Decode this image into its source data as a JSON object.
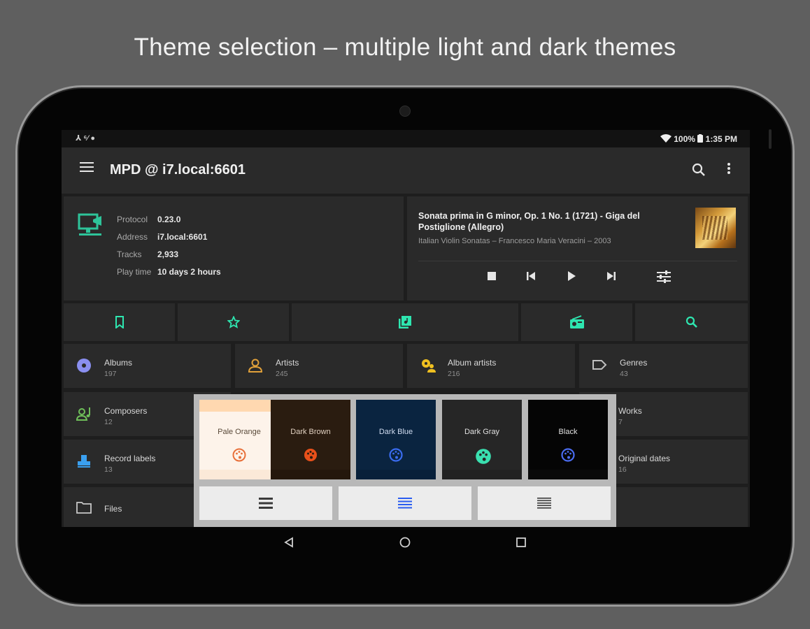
{
  "headline": "Theme selection – multiple light and dark themes",
  "status": {
    "battery": "100%",
    "time": "1:35 PM",
    "left_icons": "⅄  ⁶⁄  ●"
  },
  "toolbar": {
    "title": "MPD @ i7.local:6601",
    "search_icon": "search-icon",
    "more_icon": "more-vert-icon",
    "menu_icon": "menu-icon"
  },
  "server": {
    "rows": [
      {
        "key": "Protocol",
        "value": "0.23.0"
      },
      {
        "key": "Address",
        "value": "i7.local:6601"
      },
      {
        "key": "Tracks",
        "value": "2,933"
      },
      {
        "key": "Play time",
        "value": "10 days 2 hours"
      }
    ]
  },
  "player": {
    "track": "Sonata prima in G minor, Op. 1 No. 1 (1721) - Giga del Postiglione (Allegro)",
    "subtitle": "Italian Violin Sonatas – Francesco Maria Veracini – 2003"
  },
  "quick_actions": [
    "bookmark-icon",
    "star-icon",
    "library-icon",
    "radio-icon",
    "search-icon"
  ],
  "library": [
    {
      "name": "Albums",
      "count": "197",
      "icon": "album-icon",
      "color": "#8a8ff0"
    },
    {
      "name": "Artists",
      "count": "245",
      "icon": "person-icon",
      "color": "#e0a03a"
    },
    {
      "name": "Album artists",
      "count": "216",
      "icon": "group-icon",
      "color": "#f0c020"
    },
    {
      "name": "Genres",
      "count": "43",
      "icon": "label-icon",
      "color": "#bfbfbf"
    },
    {
      "name": "Composers",
      "count": "12",
      "icon": "composer-icon",
      "color": "#6fbf5a"
    },
    {
      "name": "Works",
      "count": "7",
      "icon": "works-icon",
      "color": "#bfbfbf"
    },
    {
      "name": "Record labels",
      "count": "13",
      "icon": "record-label-icon",
      "color": "#3aa0f0"
    },
    {
      "name": "Original dates",
      "count": "16",
      "icon": "calendar-icon",
      "color": "#bfbfbf"
    },
    {
      "name": "Files",
      "count": "",
      "icon": "folder-icon",
      "color": "#c8c8c8"
    }
  ],
  "themes": [
    {
      "name": "Pale Orange",
      "bg": "#fdf3ea",
      "top": "#ffd8b0",
      "fg": "#5a4a3a",
      "icon": "#e8703a",
      "selected": false
    },
    {
      "name": "Dark Brown",
      "bg": "#2a1c10",
      "top": "#2a1c10",
      "fg": "#e0d0c0",
      "icon": "#e8501a",
      "selected": false
    },
    {
      "name": "Dark Blue",
      "bg": "#0a2440",
      "top": "#0a2440",
      "fg": "#d0dcf0",
      "icon": "#3a6cf0",
      "selected": false
    },
    {
      "name": "Dark Gray",
      "bg": "#262626",
      "top": "#262626",
      "fg": "#e0e0e0",
      "icon": "#3ae0b0",
      "selected": false
    },
    {
      "name": "Black",
      "bg": "#050505",
      "top": "#050505",
      "fg": "#e0e0e0",
      "icon": "#4a6cf0",
      "selected": false
    }
  ],
  "layouts": [
    {
      "icon": "list-icon",
      "color": "#3a3a3a"
    },
    {
      "icon": "list-selected-icon",
      "color": "#2a5cf0"
    },
    {
      "icon": "list-compact-icon",
      "color": "#3a3a3a"
    }
  ],
  "colors": {
    "accent": "#2ee6b0",
    "background": "#1e1e1e",
    "card": "#2a2a2a"
  }
}
